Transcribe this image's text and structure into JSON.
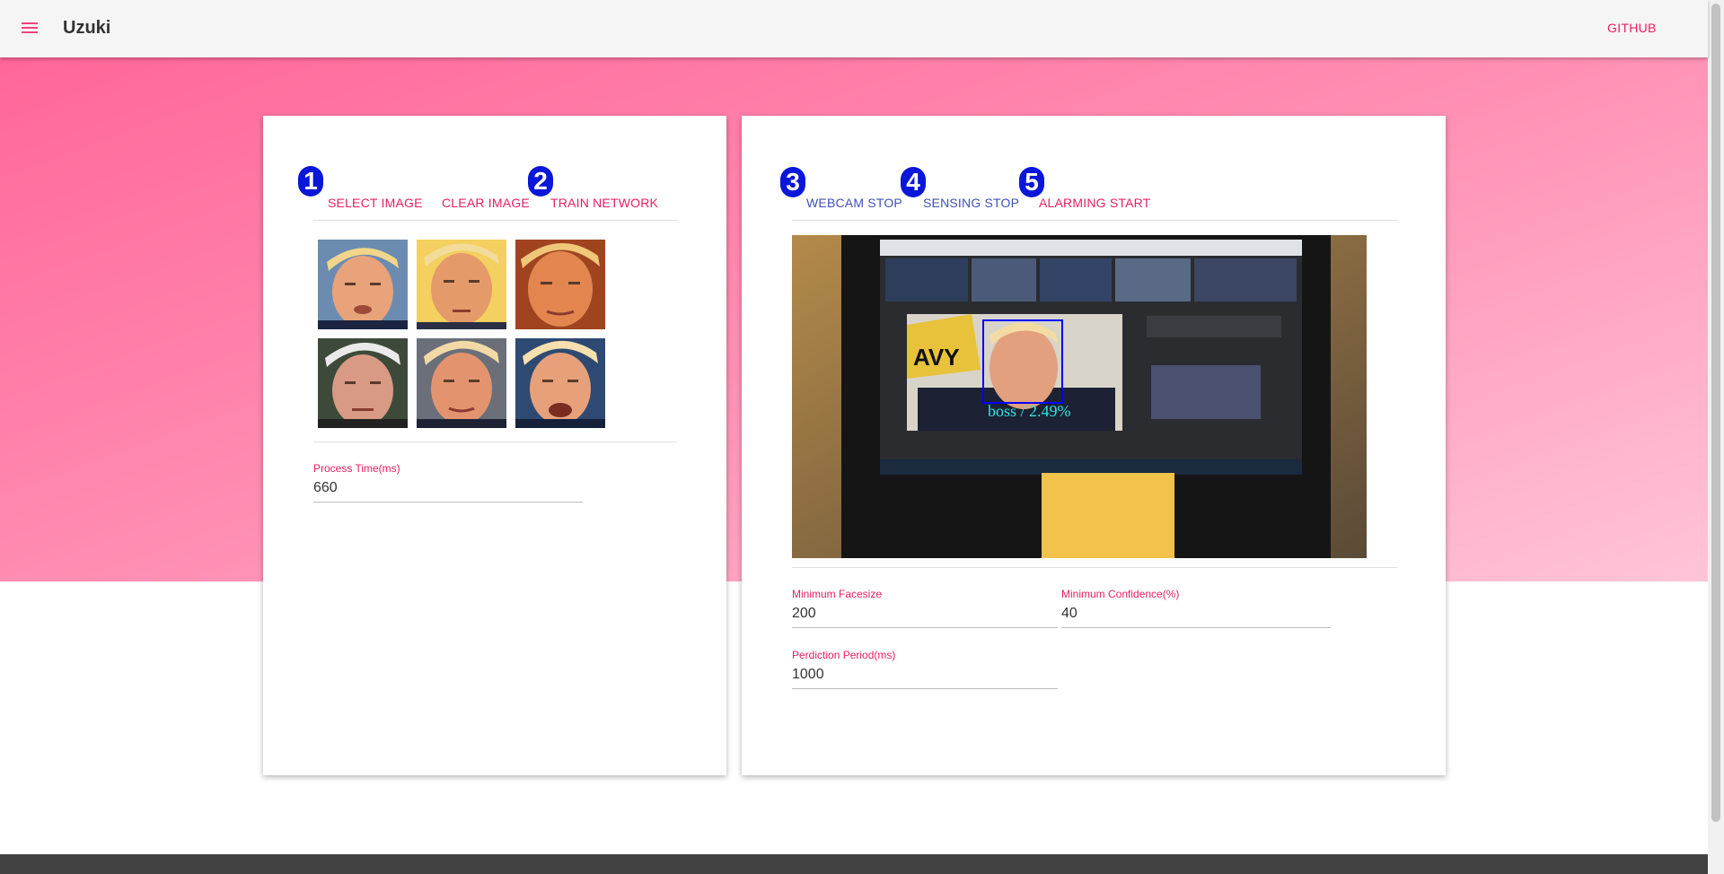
{
  "app": {
    "title": "Uzuki",
    "github_label": "GITHUB"
  },
  "colors": {
    "accent": "#e91e63",
    "primary": "#3f51b5",
    "badge": "#0a16d8"
  },
  "left_panel": {
    "buttons": [
      {
        "label": "SELECT IMAGE",
        "badge": "1"
      },
      {
        "label": "CLEAR IMAGE"
      },
      {
        "label": "TRAIN NETWORK",
        "badge": "2"
      }
    ],
    "images_count": 6,
    "process_time": {
      "label": "Process Time(ms)",
      "value": "660"
    }
  },
  "right_panel": {
    "buttons": [
      {
        "label": "WEBCAM STOP",
        "badge": "3"
      },
      {
        "label": "SENSING STOP",
        "badge": "4"
      },
      {
        "label": "ALARMING START",
        "badge": "5"
      }
    ],
    "detection_label": "boss / 2.49%",
    "fields": {
      "min_facesize": {
        "label": "Minimum Facesize",
        "value": "200"
      },
      "min_confidence": {
        "label": "Minimum Confidence(%)",
        "value": "40"
      },
      "prediction_period": {
        "label": "Perdiction Period(ms)",
        "value": "1000"
      }
    }
  }
}
